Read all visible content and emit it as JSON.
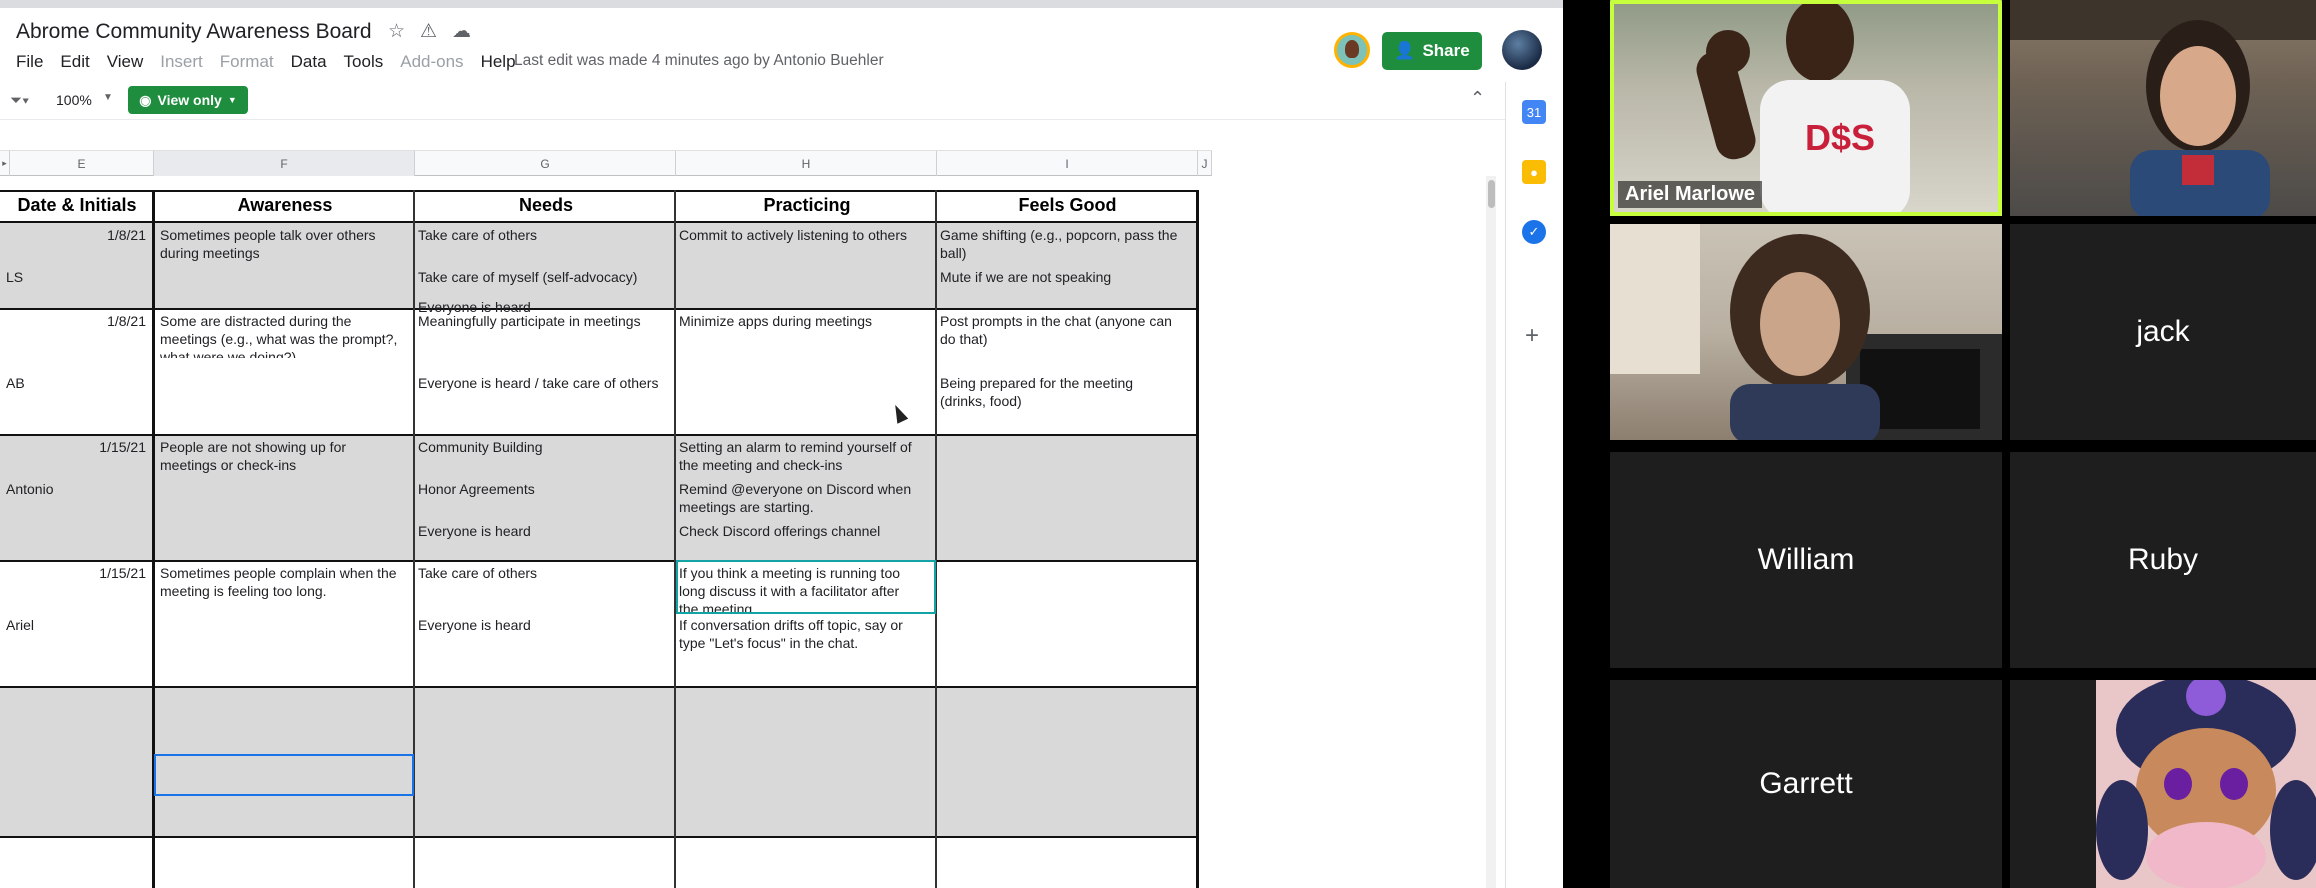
{
  "sheets": {
    "title": "Abrome Community Awareness Board",
    "menu": [
      "File",
      "Edit",
      "View",
      "Insert",
      "Format",
      "Data",
      "Tools",
      "Add-ons",
      "Help"
    ],
    "menu_disabled": [
      "Insert",
      "Format",
      "Add-ons"
    ],
    "last_edit": "Last edit was made 4 minutes ago by Antonio Buehler",
    "share_label": "Share",
    "zoom": "100%",
    "view_only_label": "View only",
    "columns": [
      "E",
      "F",
      "G",
      "H",
      "I",
      "J"
    ],
    "table_headers": [
      "Date & Initials",
      "Awareness",
      "Needs",
      "Practicing",
      "Feels Good"
    ],
    "rows": [
      {
        "date": "1/8/21",
        "initials": "LS",
        "awareness": [
          "Sometimes people talk over others",
          "during meetings"
        ],
        "needs": [
          "Take care of others",
          "Take care of myself (self-advocacy)",
          "Everyone is heard"
        ],
        "practicing": [
          "Commit to actively listening to others"
        ],
        "feels_good": [
          "Game shifting (e.g., popcorn, pass the",
          "ball)",
          "Mute if we are not speaking"
        ]
      },
      {
        "date": "1/8/21",
        "initials": "AB",
        "awareness": [
          "Some are distracted during the",
          "meetings (e.g., what was the prompt?,",
          "what were we doing?)"
        ],
        "needs": [
          "Meaningfully participate in meetings",
          "Everyone is heard / take care of others"
        ],
        "practicing": [
          "Minimize apps during meetings"
        ],
        "feels_good": [
          "Post prompts in the chat (anyone can",
          "do that)",
          "Being prepared for the meeting",
          "(drinks, food)"
        ]
      },
      {
        "date": "1/15/21",
        "initials": "Antonio",
        "awareness": [
          "People are not showing up for",
          "meetings or check-ins"
        ],
        "needs": [
          "Community Building",
          "Honor Agreements",
          "Everyone is heard"
        ],
        "practicing": [
          "Setting an alarm to remind yourself of",
          "the meeting and check-ins",
          "Remind @everyone on Discord when",
          "meetings are starting.",
          "Check Discord offerings channel"
        ],
        "feels_good": []
      },
      {
        "date": "1/15/21",
        "initials": "Ariel",
        "awareness": [
          "Sometimes people complain when the",
          "meeting is feeling too long."
        ],
        "needs": [
          "Take care of others",
          "Everyone is heard"
        ],
        "practicing": [
          "If you think a meeting is running too",
          "long discuss it with a facilitator after",
          "the meeting",
          "If conversation drifts off topic, say or",
          "type \"Let's focus\" in the chat."
        ],
        "feels_good": []
      }
    ],
    "side_panel_icons": [
      "calendar-icon",
      "keep-icon",
      "tasks-icon",
      "add-icon"
    ]
  },
  "video": {
    "participants": [
      {
        "name": "Ariel Marlowe",
        "video": true,
        "active_speaker": true
      },
      {
        "name": "",
        "video": true,
        "active_speaker": false
      },
      {
        "name": "",
        "video": true,
        "active_speaker": false
      },
      {
        "name": "jack",
        "video": false
      },
      {
        "name": "William",
        "video": false
      },
      {
        "name": "Ruby",
        "video": false
      },
      {
        "name": "Garrett",
        "video": false
      },
      {
        "name": "",
        "video": true,
        "avatar": "cartoon"
      }
    ]
  },
  "colors": {
    "share_green": "#1e8e3e",
    "active_speaker": "#c8ff3c",
    "row_shade": "#d9d9d9",
    "selection_blue": "#1a73e8"
  }
}
